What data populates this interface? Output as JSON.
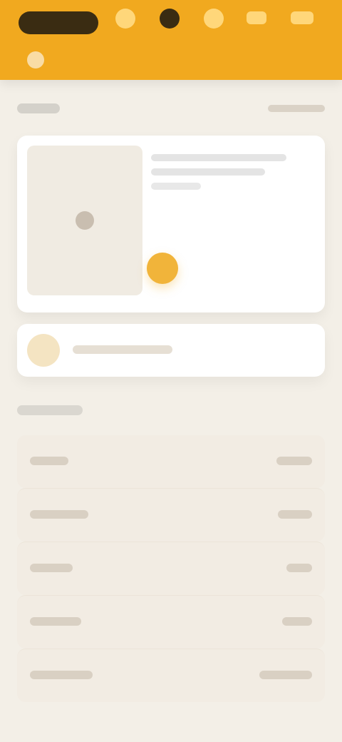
{
  "colors": {
    "accent": "#f1a91f",
    "background": "#f3efe7",
    "card": "#ffffff",
    "list_row": "#f2ece3"
  },
  "icons": {
    "top_left": "menu-pill-icon",
    "top_1": "profile-icon",
    "top_2": "notification-icon",
    "top_3": "chat-icon",
    "top_4": "more-icon",
    "product_thumb": "product-placeholder-icon",
    "promo": "promo-icon",
    "play": "play-icon"
  },
  "list": {
    "rows": [
      {},
      {},
      {},
      {},
      {}
    ]
  }
}
